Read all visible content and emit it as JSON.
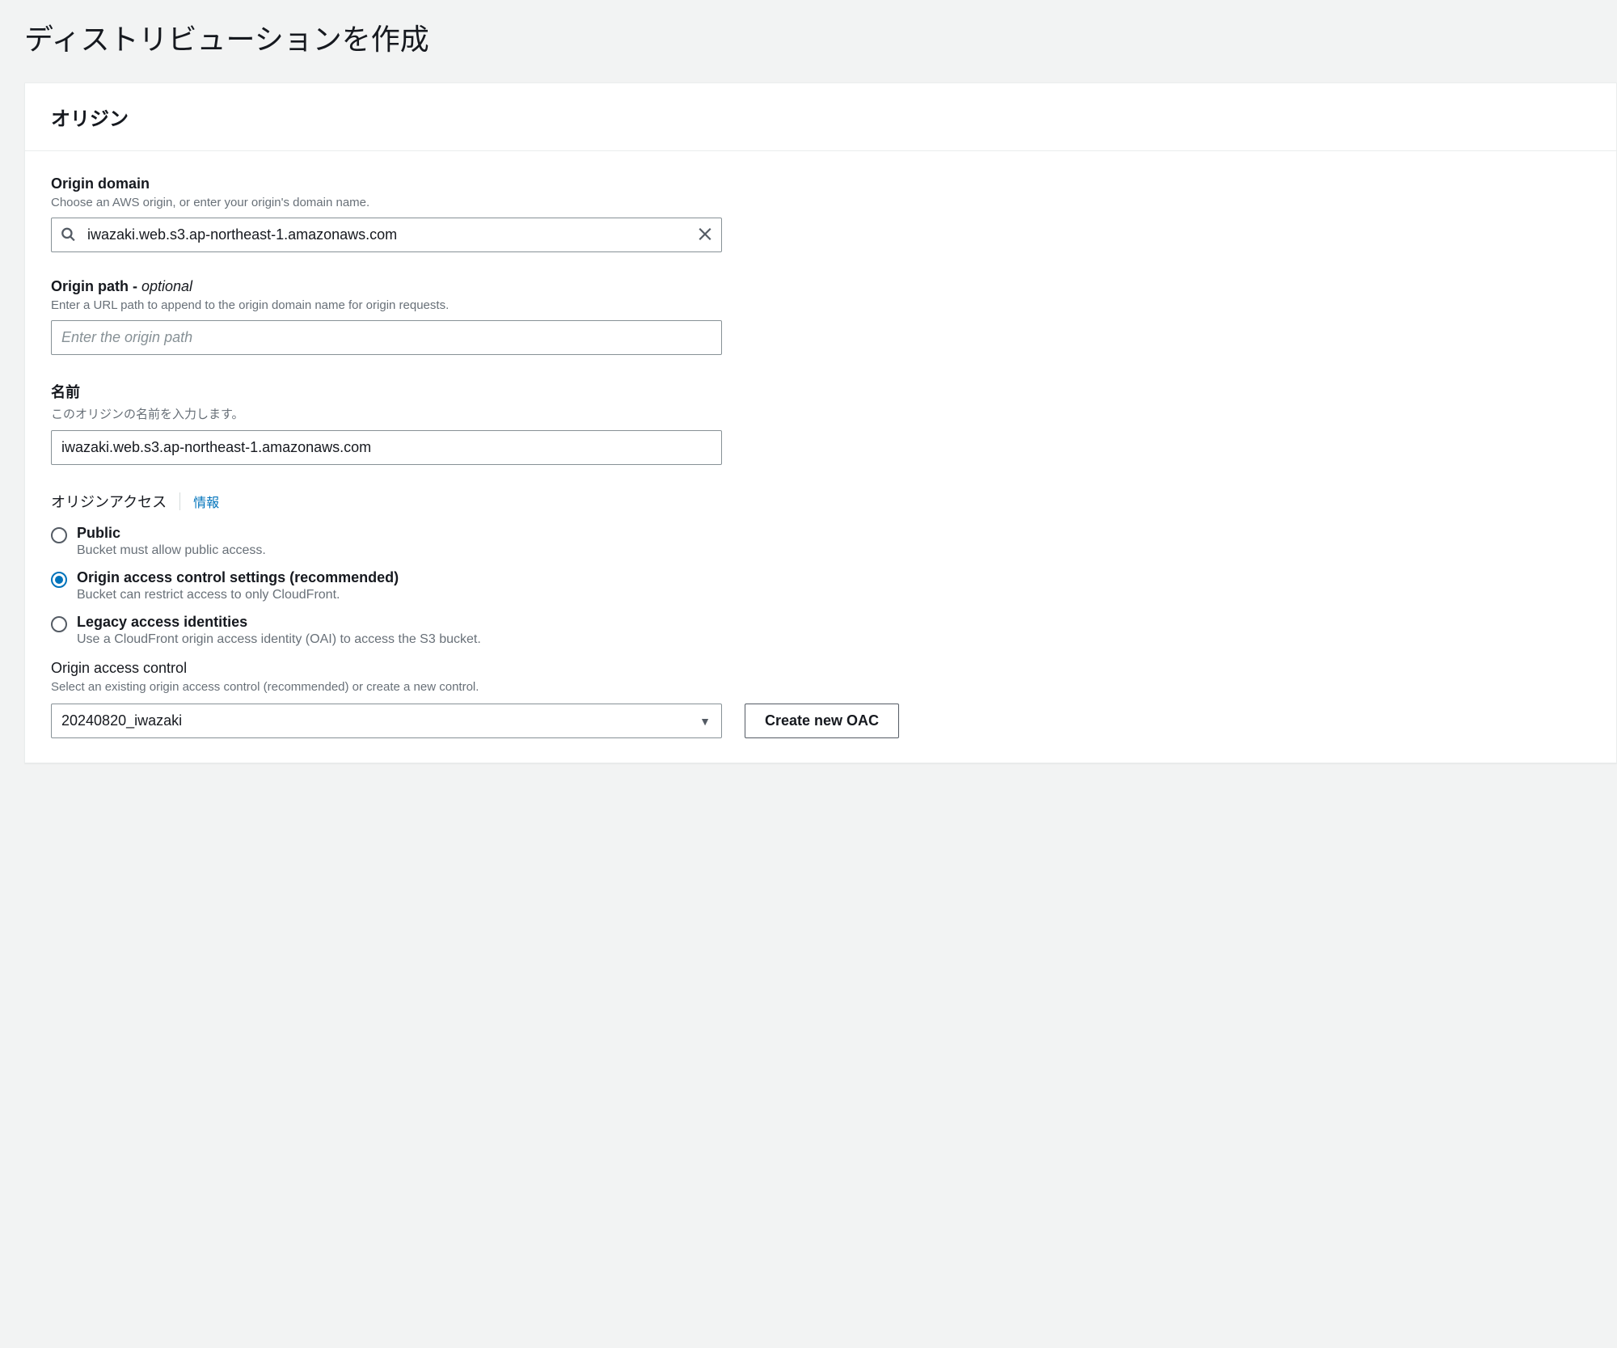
{
  "page": {
    "title": "ディストリビューションを作成"
  },
  "panel": {
    "header": "オリジン"
  },
  "origin_domain": {
    "label": "Origin domain",
    "hint": "Choose an AWS origin, or enter your origin's domain name.",
    "value": "iwazaki.web.s3.ap-northeast-1.amazonaws.com"
  },
  "origin_path": {
    "label": "Origin path - ",
    "optional": "optional",
    "hint": "Enter a URL path to append to the origin domain name for origin requests.",
    "placeholder": "Enter the origin path",
    "value": ""
  },
  "name": {
    "label": "名前",
    "hint": "このオリジンの名前を入力します。",
    "value": "iwazaki.web.s3.ap-northeast-1.amazonaws.com"
  },
  "origin_access": {
    "title": "オリジンアクセス",
    "info_link": "情報",
    "options": [
      {
        "label": "Public",
        "desc": "Bucket must allow public access.",
        "checked": false
      },
      {
        "label": "Origin access control settings (recommended)",
        "desc": "Bucket can restrict access to only CloudFront.",
        "checked": true
      },
      {
        "label": "Legacy access identities",
        "desc": "Use a CloudFront origin access identity (OAI) to access the S3 bucket.",
        "checked": false
      }
    ]
  },
  "oac": {
    "label": "Origin access control",
    "hint": "Select an existing origin access control (recommended) or create a new control.",
    "selected": "20240820_iwazaki",
    "create_button": "Create new OAC"
  }
}
